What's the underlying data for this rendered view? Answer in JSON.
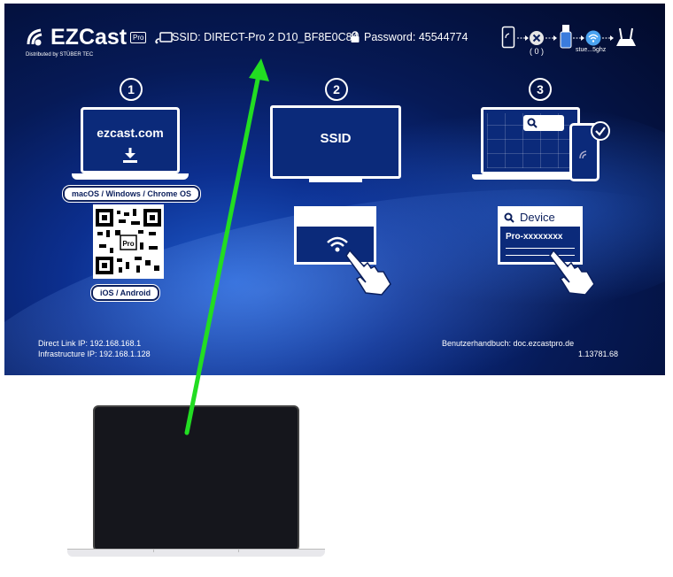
{
  "brand": {
    "name": "EZCast",
    "pro": "Pro",
    "distributed": "Distributed by STÜBER TEC"
  },
  "header": {
    "ssid": "SSID: DIRECT-Pro 2 D10_BF8E0C84",
    "password": "Password: 45544774",
    "conn_count": "( 0 )",
    "wifi_label": "stue...5ghz"
  },
  "steps": [
    {
      "num": "1",
      "laptop_url": "ezcast.com",
      "platforms": "macOS / Windows / Chrome OS",
      "mobile": "iOS / Android"
    },
    {
      "num": "2",
      "tv_label": "SSID"
    },
    {
      "num": "3",
      "search_label": "Device",
      "device_name": "Pro-xxxxxxxx"
    }
  ],
  "footer": {
    "direct_ip": "Direct Link IP: 192.168.168.1",
    "infra_ip": "Infrastructure IP: 192.168.1.128",
    "manual": "Benutzerhandbuch: doc.ezcastpro.de",
    "version": "1.13781.68"
  },
  "colors": {
    "arrow": "#22dd22",
    "bg_dark": "#020a2a",
    "bg_mid": "#0c2f8f"
  }
}
